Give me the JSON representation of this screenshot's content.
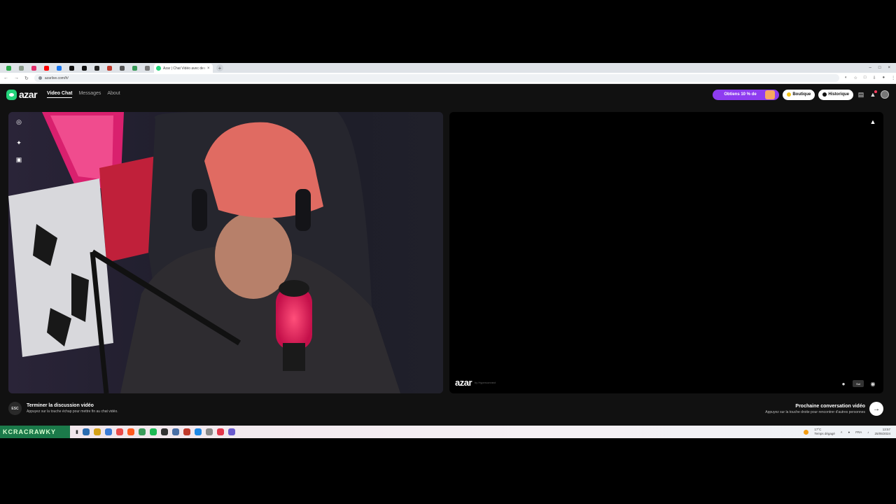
{
  "browser": {
    "tabs": [
      {
        "icon": "spreadsheet-icon",
        "color": "#2aa84a"
      },
      {
        "icon": "shield-icon",
        "color": "#8a9a8a"
      },
      {
        "icon": "instagram-icon",
        "color": "#e1306c"
      },
      {
        "icon": "youtube-icon",
        "color": "#ff0000"
      },
      {
        "icon": "facebook-icon",
        "color": "#1877f2"
      },
      {
        "icon": "x-icon",
        "color": "#111111"
      },
      {
        "icon": "x-icon",
        "color": "#111111"
      },
      {
        "icon": "app-icon",
        "color": "#222222"
      },
      {
        "icon": "app-icon",
        "color": "#c0392b"
      },
      {
        "icon": "app-icon",
        "color": "#555555"
      },
      {
        "icon": "app-icon",
        "color": "#3a9a5a"
      },
      {
        "icon": "app-icon",
        "color": "#777777"
      }
    ],
    "active_tab": {
      "title": "Azar | Chat Vidéo avec de n",
      "close": "×"
    },
    "new_tab": "+",
    "window_controls": [
      "–",
      "□",
      "×"
    ],
    "url": "azarlive.com/fr/"
  },
  "header": {
    "logo_text": "azar",
    "nav": [
      {
        "label": "Video Chat",
        "active": true
      },
      {
        "label": "Messages",
        "active": false
      },
      {
        "label": "About",
        "active": false
      }
    ],
    "promo_label": "Obtiens 10 % de",
    "boutique_label": "Boutique",
    "historique_label": "Historique"
  },
  "video_right": {
    "logo_text": "azar",
    "logo_sub": "by Hyperconnect",
    "badge_text": "Sol"
  },
  "controls": {
    "esc_key": "ESC",
    "end_title": "Terminer la discussion vidéo",
    "end_sub": "Appuyez sur la touche échap pour mettre fin au chat vidéo.",
    "next_title": "Prochaine conversation vidéo",
    "next_sub": "Appuyez sur la touche droite pour rencontrer d'autres personnes",
    "next_arrow": "→"
  },
  "taskbar": {
    "brand": "KCRACRAWKY",
    "apps": [
      "#2b6cb0",
      "#d4a017",
      "#3a7bd5",
      "#e84a4a",
      "#ff5a1f",
      "#3a9a5a",
      "#1db954",
      "#333333",
      "#4a6fa5",
      "#c0392b",
      "#1e88e5",
      "#888888",
      "#e2374b",
      "#6a5acd"
    ],
    "weather": "17°C",
    "weather_sub": "Temps dégagé",
    "lang": "FRA",
    "time": "13:57",
    "date": "25/05/2024"
  }
}
